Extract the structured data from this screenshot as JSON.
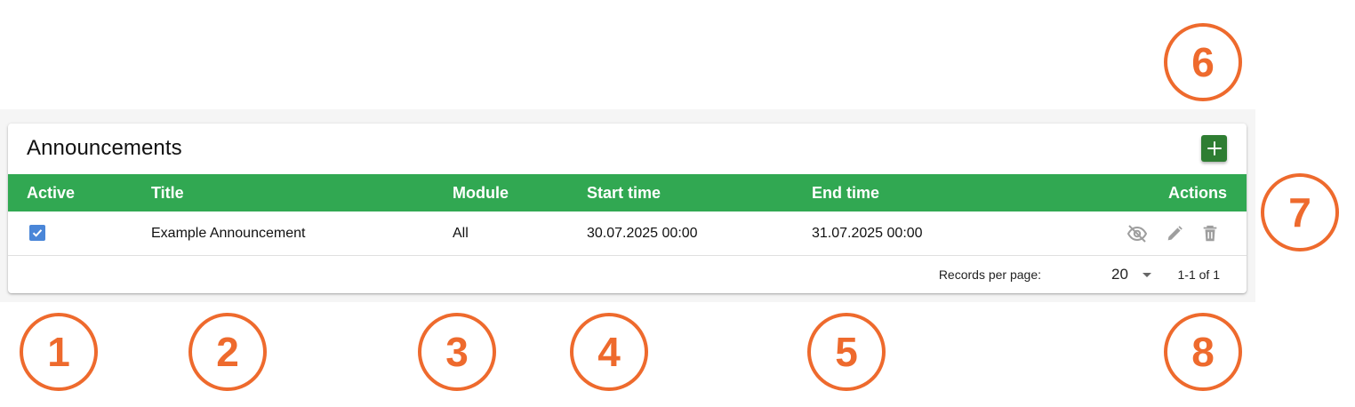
{
  "panel": {
    "title": "Announcements",
    "add_icon": "plus-icon"
  },
  "table": {
    "columns": [
      "Active",
      "Title",
      "Module",
      "Start time",
      "End time",
      "Actions"
    ],
    "rows": [
      {
        "active": true,
        "title": "Example Announcement",
        "module": "All",
        "start_time": "30.07.2025 00:00",
        "end_time": "31.07.2025 00:00",
        "actions": [
          "eye-off-icon",
          "pencil-icon",
          "trash-icon"
        ]
      }
    ]
  },
  "pagination": {
    "records_per_page_label": "Records per page:",
    "records_per_page_value": "20",
    "range": "1-1 of 1"
  },
  "callouts": [
    "1",
    "2",
    "3",
    "4",
    "5",
    "6",
    "7",
    "8"
  ],
  "colors": {
    "header_green": "#31a852",
    "add_button_green": "#2e7d32",
    "checkbox_blue": "#4a86d8",
    "callout_orange": "#ee6a2d",
    "icon_grey": "#9e9e9e"
  }
}
